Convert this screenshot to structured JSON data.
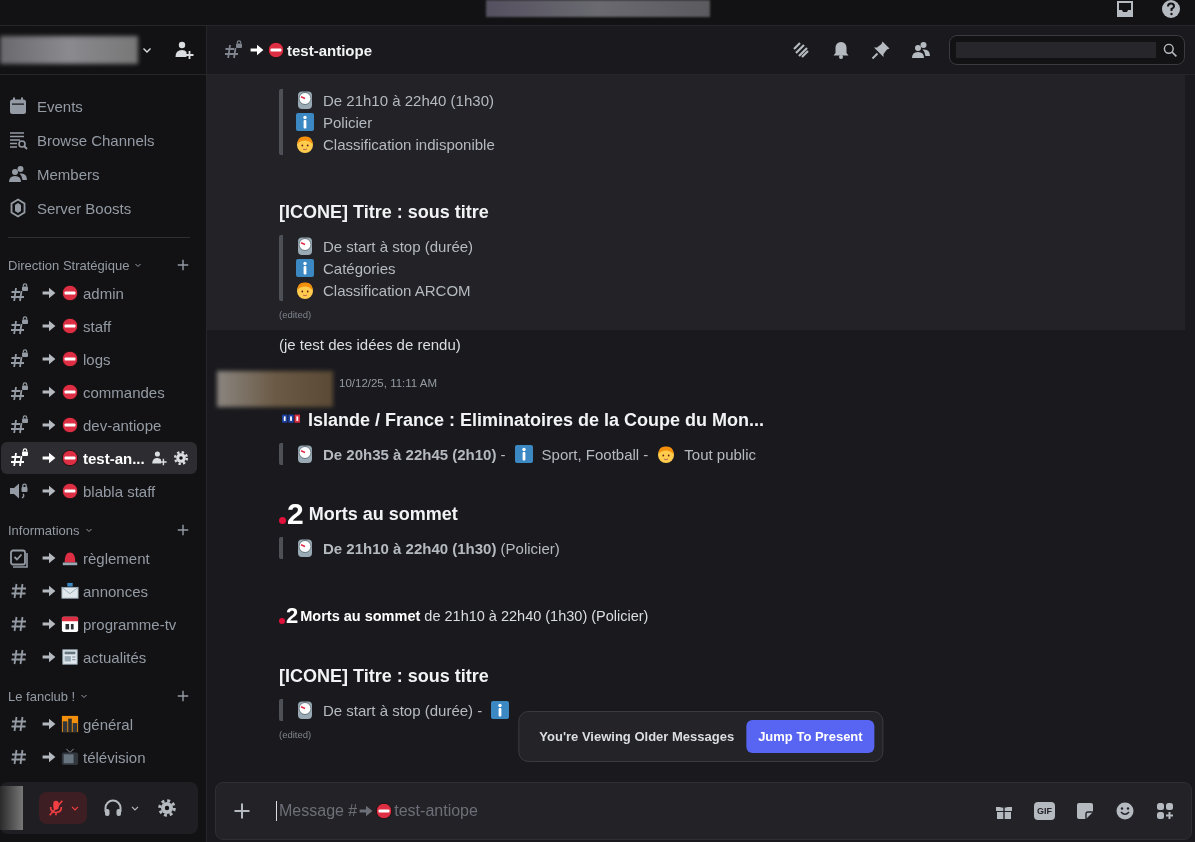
{
  "header": {
    "channel": "test-antiope"
  },
  "sidebar": {
    "nav": [
      {
        "kind": "events",
        "label": "Events"
      },
      {
        "kind": "browse",
        "label": "Browse Channels"
      },
      {
        "kind": "members",
        "label": "Members"
      },
      {
        "kind": "boosts",
        "label": "Server Boosts"
      }
    ],
    "categories": [
      {
        "name": "Direction Stratégique",
        "channels": [
          {
            "kind": "text_locked",
            "label": "admin",
            "selected": false
          },
          {
            "kind": "text_locked",
            "label": "staff",
            "selected": false
          },
          {
            "kind": "text_locked",
            "label": "logs",
            "selected": false
          },
          {
            "kind": "text_locked",
            "label": "commandes",
            "selected": false
          },
          {
            "kind": "text_locked",
            "label": "dev-antiope",
            "selected": false
          },
          {
            "kind": "text_locked",
            "label": "test-an...",
            "selected": true
          },
          {
            "kind": "voice_locked",
            "label": "blabla staff",
            "selected": false
          }
        ]
      },
      {
        "name": "Informations",
        "channels": [
          {
            "kind": "rules",
            "label": "règlement",
            "selected": false
          },
          {
            "kind": "text",
            "label": "annonces",
            "selected": false
          },
          {
            "kind": "text",
            "label": "programme-tv",
            "selected": false
          },
          {
            "kind": "text",
            "label": "actualités",
            "selected": false
          }
        ]
      },
      {
        "name": "Le fanclub !",
        "channels": [
          {
            "kind": "text",
            "label": "général",
            "selected": false
          },
          {
            "kind": "text",
            "label": "télévision",
            "selected": false
          }
        ]
      }
    ]
  },
  "user_panel": {
    "mic_muted": true
  },
  "messages": [
    {
      "highlighted": true,
      "blocks": [
        {
          "kind": "quote_stack",
          "parts": [
            {
              "kind": "time",
              "text": "De 21h10 à 22h40 (1h30)"
            },
            {
              "kind": "genre",
              "text": "Policier"
            },
            {
              "kind": "rating",
              "text": "Classification indisponible"
            }
          ]
        },
        {
          "kind": "heading",
          "text": "[ICONE] Titre : sous titre"
        },
        {
          "kind": "quote_stack",
          "parts": [
            {
              "kind": "time",
              "text": "De start à stop (durée)"
            },
            {
              "kind": "genre",
              "text": "Catégories"
            },
            {
              "kind": "rating",
              "text": "Classification ARCOM"
            }
          ]
        }
      ],
      "edited": "(edited)"
    },
    {
      "highlighted": false,
      "blocks": [
        {
          "kind": "text",
          "text": "(je test des idées de rendu)"
        }
      ]
    },
    {
      "highlighted": false,
      "timestamp": "10/12/25, 11:11 AM",
      "blocks": [
        {
          "kind": "heading_tf1",
          "text": "Islande / France : Eliminatoires de la Coupe du Mon..."
        },
        {
          "kind": "quote_inline",
          "parts": [
            {
              "kind": "time",
              "text": "**De 20h35 à 22h45 (2h10)** -"
            },
            {
              "kind": "genre",
              "text": "Sport, Football -"
            },
            {
              "kind": "rating",
              "text": "Tout public"
            }
          ]
        },
        {
          "kind": "heading_f2",
          "logo_text": "2",
          "text": "Morts au sommet"
        },
        {
          "kind": "quote_inline",
          "parts": [
            {
              "kind": "time",
              "text": "**De 21h10 à 22h40 (1h30)** (Policier)"
            }
          ]
        },
        {
          "kind": "small",
          "logo_text": "2",
          "text": "**Morts au sommet** de 21h10 à 22h40 (1h30) (Policier)"
        },
        {
          "kind": "heading",
          "text": "[ICONE] Titre : sous titre"
        },
        {
          "kind": "quote_inline",
          "parts": [
            {
              "kind": "time",
              "text": "De start à stop (durée) -"
            },
            {
              "kind": "genre"
            }
          ]
        }
      ],
      "edited": "(edited)"
    }
  ],
  "older_banner": {
    "text": "You're Viewing Older Messages",
    "button": "Jump To Present"
  },
  "composer": {
    "placeholder_prefix": "Message #",
    "placeholder_channel": "test-antiope",
    "gif": "GIF"
  }
}
